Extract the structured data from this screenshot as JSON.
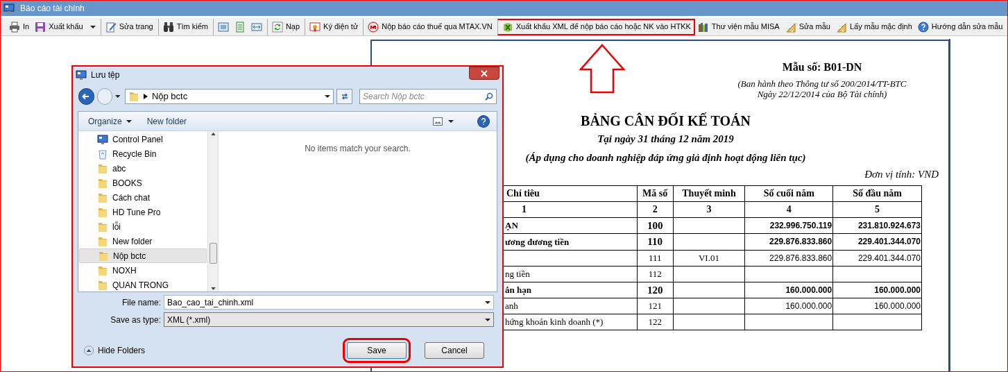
{
  "window": {
    "title": "Báo cáo tài chính"
  },
  "toolbar": [
    {
      "kind": "printer",
      "label": "In",
      "separator_before": false,
      "dropdown": false,
      "highlighted": false
    },
    {
      "kind": "disk",
      "label": "Xuất khẩu",
      "separator_before": false,
      "dropdown": true,
      "highlighted": false
    },
    {
      "kind": "edit",
      "label": "Sửa trang",
      "separator_before": true,
      "dropdown": false,
      "highlighted": false
    },
    {
      "kind": "binoculars",
      "label": "Tìm kiếm",
      "separator_before": true,
      "dropdown": false,
      "highlighted": false
    },
    {
      "kind": "page-wide",
      "separator_before": true,
      "dropdown": false,
      "highlighted": false
    },
    {
      "kind": "page",
      "separator_before": false,
      "dropdown": false,
      "highlighted": false
    },
    {
      "kind": "page-fit",
      "separator_before": false,
      "dropdown": false,
      "highlighted": false
    },
    {
      "kind": "refresh",
      "label": "Nạp",
      "separator_before": true,
      "dropdown": false,
      "highlighted": false
    },
    {
      "kind": "certificate",
      "label": "Ký điện tử",
      "separator_before": true,
      "dropdown": false,
      "highlighted": false
    },
    {
      "kind": "m-logo",
      "label": "Nộp báo cáo thuế qua MTAX.VN",
      "separator_before": true,
      "dropdown": false,
      "highlighted": false
    },
    {
      "kind": "excel",
      "label": "Xuất khẩu XML để nộp báo cáo hoặc NK vào HTKK",
      "separator_before": true,
      "dropdown": false,
      "highlighted": true
    },
    {
      "kind": "books",
      "label": "Thư viện mẫu MISA",
      "separator_before": false,
      "dropdown": false,
      "highlighted": false
    },
    {
      "kind": "ruler",
      "label": "Sửa mẫu",
      "separator_before": false,
      "dropdown": false,
      "highlighted": false
    },
    {
      "kind": "ruler",
      "label": "Lấy mẫu mặc định",
      "separator_before": false,
      "dropdown": false,
      "highlighted": false
    },
    {
      "kind": "help",
      "label": "Hướng dẫn sửa mẫu",
      "separator_before": false,
      "dropdown": false,
      "highlighted": false
    }
  ],
  "report": {
    "form_number": "Mẫu số: B01-DN",
    "issued_by": [
      "(Ban hành theo Thông tư số 200/2014/TT-BTC",
      "Ngày 22/12/2014 của Bộ Tài chính)"
    ],
    "title": "BẢNG CÂN ĐỐI KẾ TOÁN",
    "date": "Tại ngày 31 tháng 12 năm 2019",
    "applies": "(Áp dụng cho doanh nghiệp đáp ứng giả định hoạt động liên tục)",
    "unit": "Đơn vị tính: VND",
    "table": {
      "columns": [
        "Chỉ tiêu",
        "Mã số",
        "Thuyết minh",
        "Số cuối năm",
        "Số đầu năm"
      ],
      "column_numbers": [
        "1",
        "2",
        "3",
        "4",
        "5"
      ],
      "rows": [
        {
          "item": "ẠN",
          "code": "100",
          "note": "",
          "end": "232.996.750.119",
          "start": "231.810.924.673",
          "bold": true
        },
        {
          "item": "ương đương tiền",
          "code": "110",
          "note": "",
          "end": "229.876.833.860",
          "start": "229.401.344.070",
          "bold": true
        },
        {
          "item": "",
          "code": "111",
          "note": "VI.01",
          "end": "229.876.833.860",
          "start": "229.401.344.070",
          "bold": false
        },
        {
          "item": "ng tiền",
          "code": "112",
          "note": "",
          "end": "",
          "start": "",
          "bold": false
        },
        {
          "item": "ắn hạn",
          "code": "120",
          "note": "",
          "end": "160.000.000",
          "start": "160.000.000",
          "bold": true
        },
        {
          "item": "anh",
          "code": "121",
          "note": "",
          "end": "160.000.000",
          "start": "160.000.000",
          "bold": false
        },
        {
          "item": "hứng khoán kinh doanh (*)",
          "code": "122",
          "note": "",
          "end": "",
          "start": "",
          "bold": false
        }
      ]
    }
  },
  "dialog": {
    "title": "Lưu tệp",
    "path": "Nộp bctc",
    "search": {
      "placeholder": "Search Nộp bctc"
    },
    "commands": [
      "Organize",
      "New folder"
    ],
    "nav_items": [
      {
        "kind": "control-panel",
        "label": "Control Panel",
        "selected": false
      },
      {
        "kind": "recycle-bin",
        "label": "Recycle Bin",
        "selected": false
      },
      {
        "kind": "folder",
        "label": "abc",
        "selected": false
      },
      {
        "kind": "folder",
        "label": "BOOKS",
        "selected": false
      },
      {
        "kind": "folder",
        "label": "Cách chat",
        "selected": false
      },
      {
        "kind": "folder",
        "label": "HD Tune Pro",
        "selected": false
      },
      {
        "kind": "folder",
        "label": "lỗi",
        "selected": false
      },
      {
        "kind": "folder",
        "label": "New folder",
        "selected": false
      },
      {
        "kind": "folder",
        "label": "Nộp bctc",
        "selected": true
      },
      {
        "kind": "folder",
        "label": "NOXH",
        "selected": false
      },
      {
        "kind": "folder",
        "label": "QUAN TRONG",
        "selected": false
      }
    ],
    "empty_message": "No items match your search.",
    "file_name": {
      "label": "File name:",
      "value": "Bao_cao_tai_chinh.xml"
    },
    "save_as_type": {
      "label": "Save as type:",
      "value": "XML (*.xml)"
    },
    "hide_folders": "Hide Folders",
    "buttons": [
      {
        "label": "Save",
        "highlighted": true
      },
      {
        "label": "Cancel",
        "highlighted": false
      }
    ]
  }
}
